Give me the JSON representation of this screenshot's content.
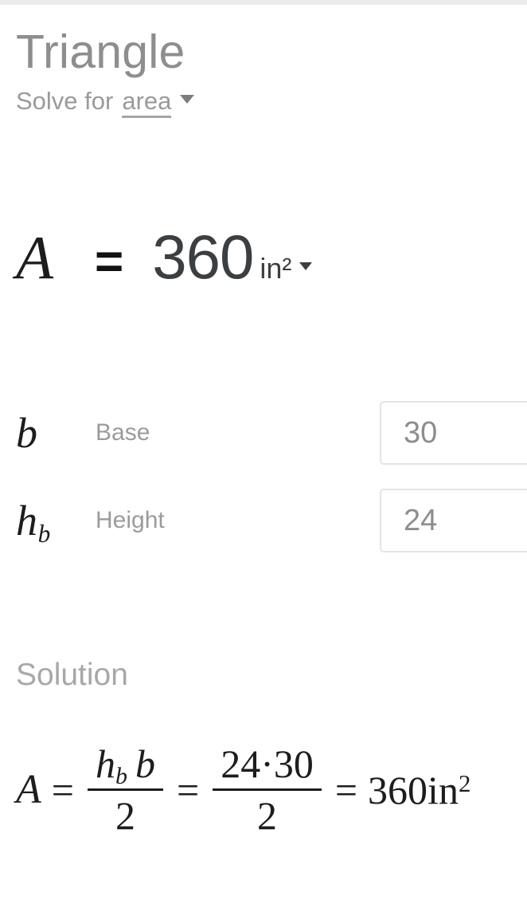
{
  "app": {
    "title": "Triangle"
  },
  "header": {
    "solve_for_label": "Solve for",
    "solve_for_value": "area",
    "dropdown_icon": "chevron-down-icon"
  },
  "result": {
    "variable": "A",
    "equals": "=",
    "value": "360",
    "unit": "in²",
    "unit_dropdown_icon": "chevron-down-icon"
  },
  "fields": [
    {
      "symbol": "b",
      "symbol_sub": "",
      "label": "Base",
      "value": "30",
      "placeholder": ""
    },
    {
      "symbol": "h",
      "symbol_sub": "b",
      "label": "Height",
      "value": "24",
      "placeholder": ""
    }
  ],
  "solution": {
    "heading": "Solution",
    "equation": {
      "lhs": "A",
      "eq1": "=",
      "formula": {
        "numerator_var1": "h",
        "numerator_var1_sub": "b",
        "numerator_var2": "b",
        "denominator": "2"
      },
      "eq2": "=",
      "substituted": {
        "numerator": "24·30",
        "denominator": "2"
      },
      "eq3": "=",
      "result": "360in",
      "result_exponent": "2"
    }
  },
  "colors": {
    "top_strip": "#ebebeb",
    "title_gray": "#8e8e8e",
    "label_gray": "#9b9b9b",
    "text_dark": "#1d1d1d",
    "value_dark": "#3c3f41",
    "input_border": "#e4e4e4",
    "background": "#ffffff"
  }
}
